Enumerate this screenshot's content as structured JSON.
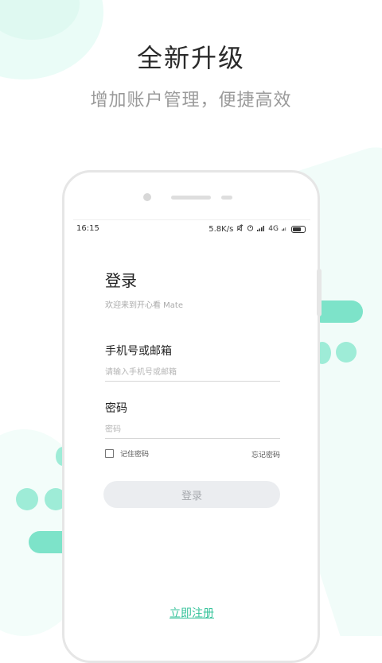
{
  "promo": {
    "headline": "全新升级",
    "subline": "增加账户管理，便捷高效"
  },
  "status_bar": {
    "time": "16:15",
    "network_speed": "5.8K/s",
    "network_type": "4G",
    "icons": [
      "mute-icon",
      "alarm-icon",
      "signal-icon",
      "battery-icon"
    ]
  },
  "login": {
    "title": "登录",
    "subtitle": "欢迎来到开心看 Mate",
    "phone_label": "手机号或邮箱",
    "phone_placeholder": "请输入手机号或邮箱",
    "password_label": "密码",
    "password_placeholder": "密码",
    "remember_label": "记住密码",
    "forgot_label": "忘记密码",
    "submit_label": "登录",
    "register_label": "立即注册"
  },
  "colors": {
    "accent": "#37c39b",
    "decor_mint": "#7de3c9",
    "button_bg": "#ebedf0"
  }
}
